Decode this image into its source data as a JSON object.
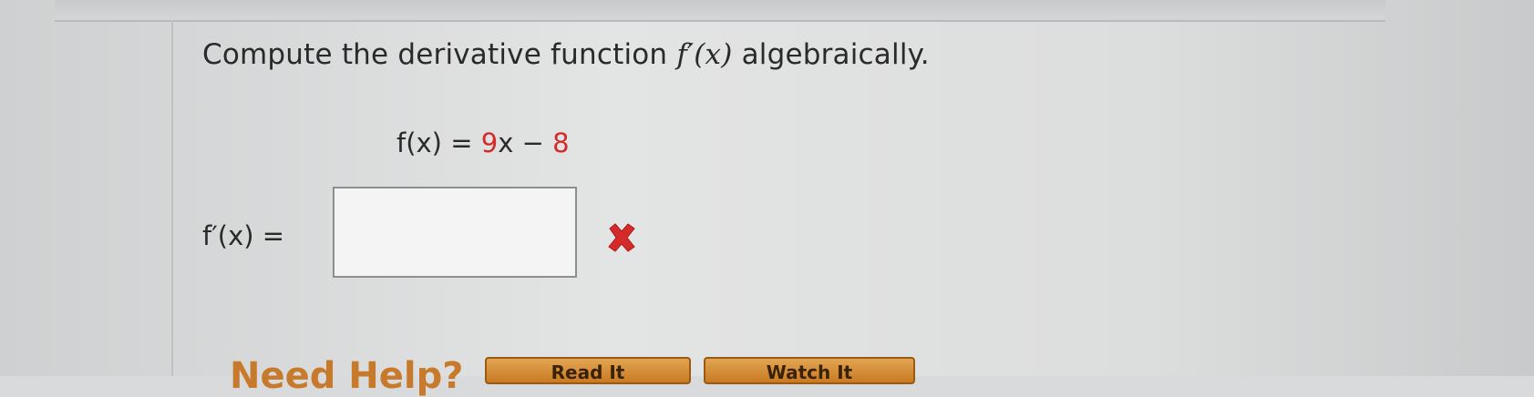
{
  "question": {
    "prefix": "Compute the derivative function ",
    "notation": "f′(x)",
    "suffix": " algebraically."
  },
  "function_def": {
    "lhs": "f(x) = ",
    "coef": "9",
    "var": "x − ",
    "constant": "8"
  },
  "answer": {
    "label": "f′(x) =",
    "value": "",
    "status_icon": "red-x-icon",
    "status_color": "#d42a2a"
  },
  "help": {
    "label": "Need Help?",
    "buttons": [
      {
        "label": "Read It"
      },
      {
        "label": "Watch It"
      }
    ]
  }
}
